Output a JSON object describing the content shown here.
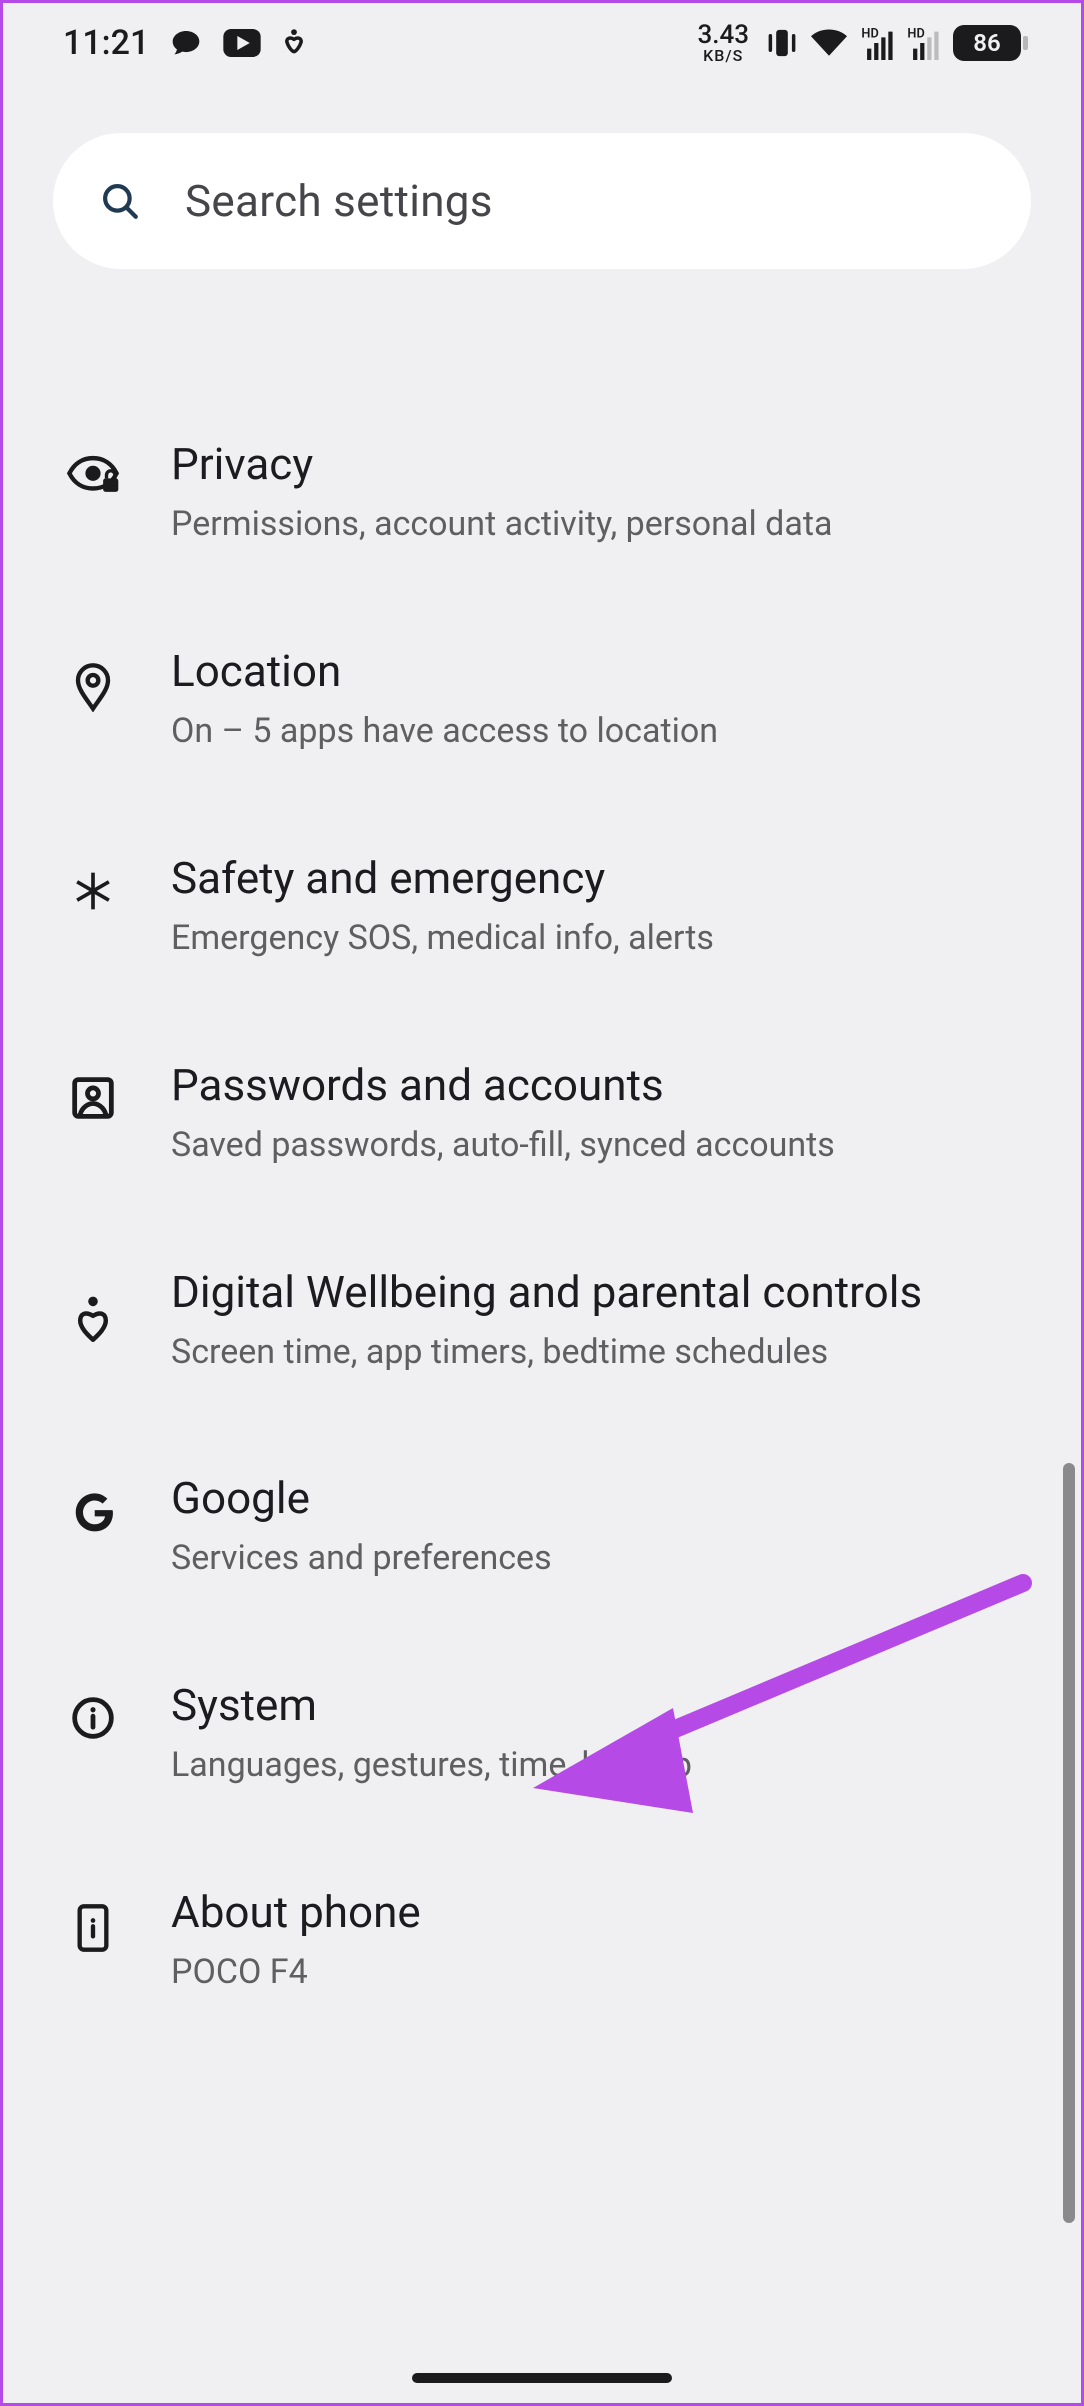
{
  "status_bar": {
    "time": "11:21",
    "data_rate": "3.43",
    "data_rate_unit": "KB/S",
    "battery": "86"
  },
  "search": {
    "placeholder": "Search settings"
  },
  "settings": [
    {
      "id": "privacy",
      "title": "Privacy",
      "subtitle": "Permissions, account activity, personal data"
    },
    {
      "id": "location",
      "title": "Location",
      "subtitle": "On – 5 apps have access to location"
    },
    {
      "id": "safety",
      "title": "Safety and emergency",
      "subtitle": "Emergency SOS, medical info, alerts"
    },
    {
      "id": "passwords",
      "title": "Passwords and accounts",
      "subtitle": "Saved passwords, auto-fill, synced accounts"
    },
    {
      "id": "wellbeing",
      "title": "Digital Wellbeing and parental controls",
      "subtitle": "Screen time, app timers, bedtime schedules"
    },
    {
      "id": "google",
      "title": "Google",
      "subtitle": "Services and preferences"
    },
    {
      "id": "system",
      "title": "System",
      "subtitle": "Languages, gestures, time, backup"
    },
    {
      "id": "about",
      "title": "About phone",
      "subtitle": "POCO F4"
    }
  ]
}
